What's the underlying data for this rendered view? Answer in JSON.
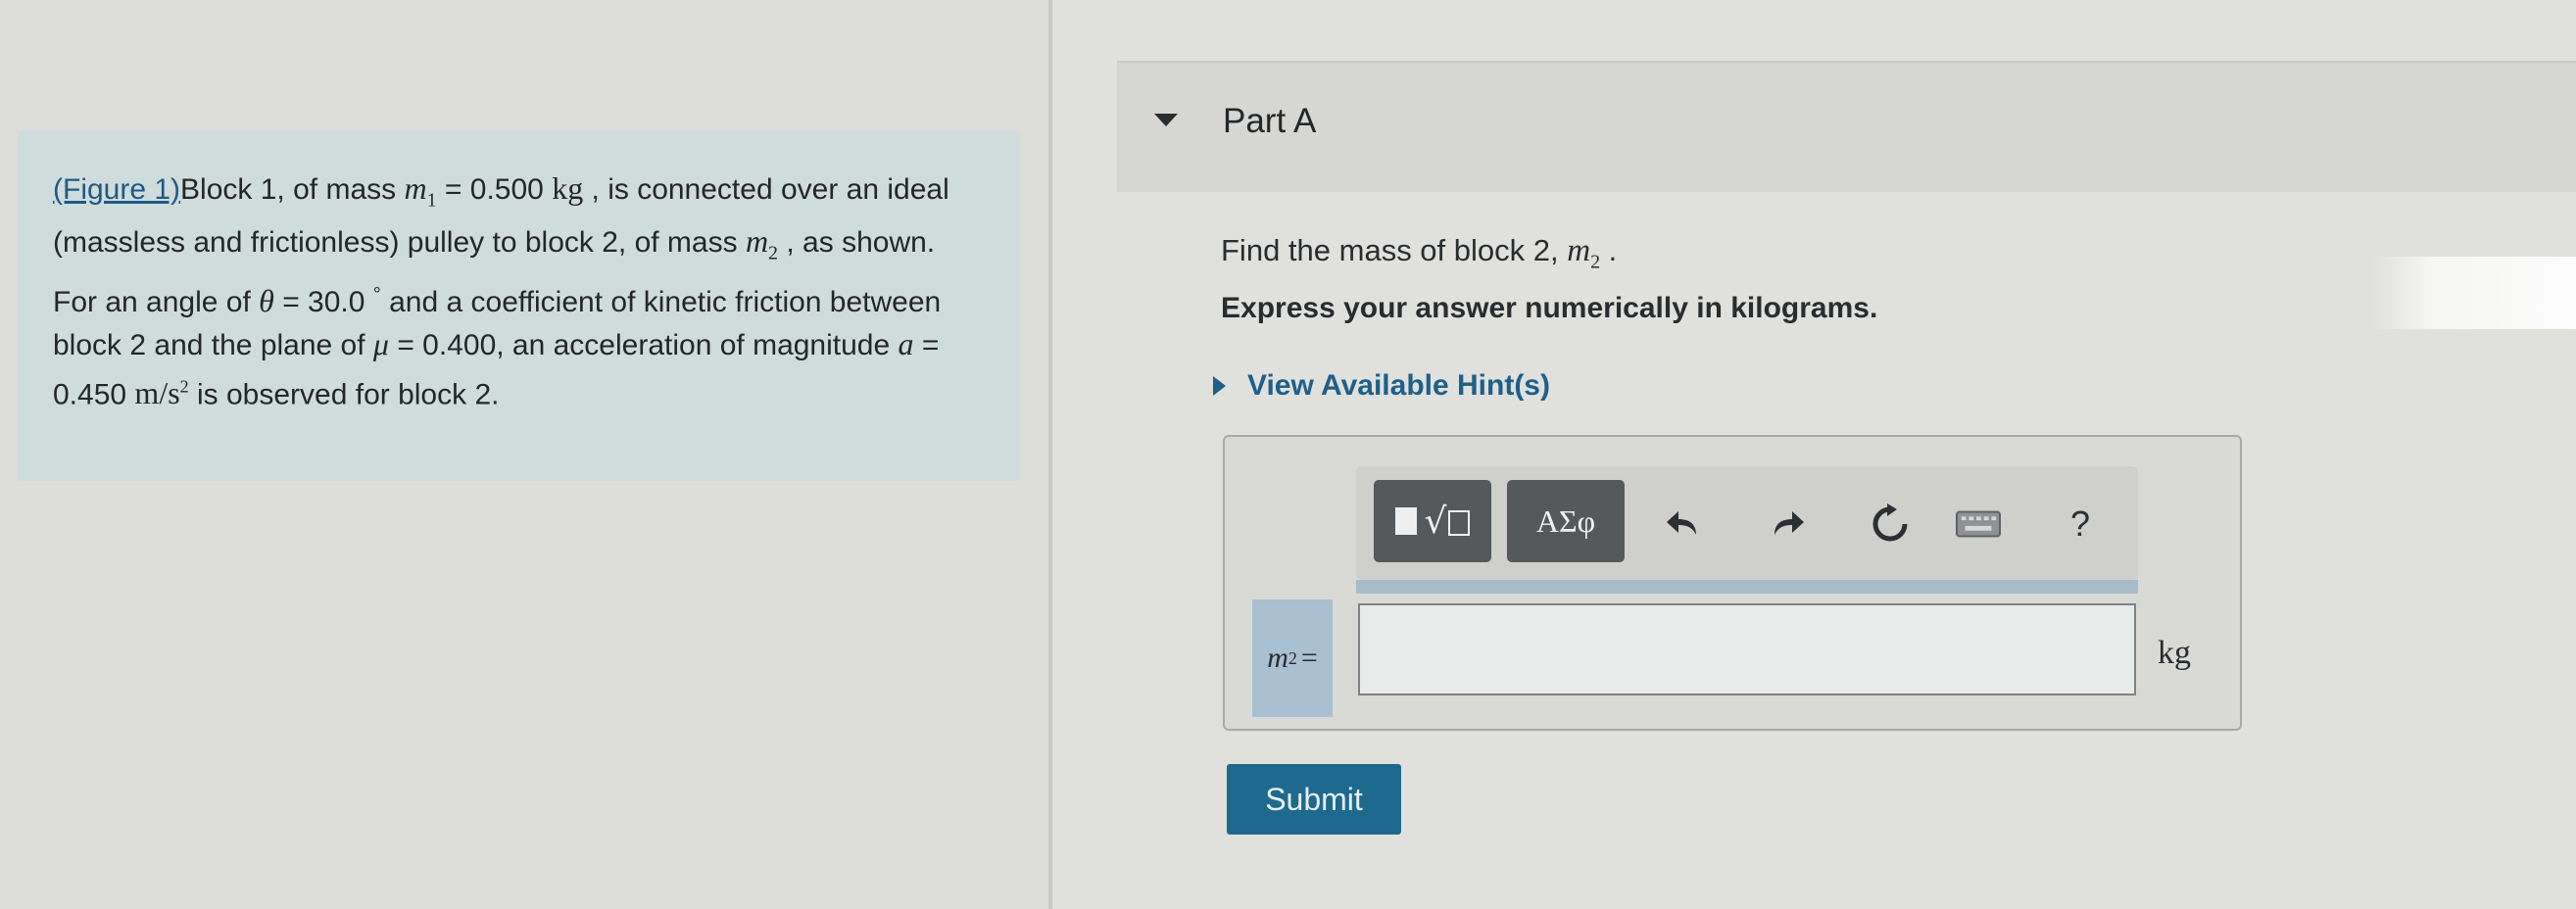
{
  "problem": {
    "figure_link": "(Figure 1)",
    "text_parts": {
      "p1": "Block 1, of mass ",
      "m1_symbol": "m",
      "m1_sub": "1",
      "eq1": " = 0.500 ",
      "unit_kg": "kg",
      "p2": " , is connected over an ideal (massless and frictionless) pulley to block 2, of mass ",
      "m2_symbol": "m",
      "m2_sub": "2",
      "p3": " , as shown. For an angle of ",
      "theta": "θ",
      "eq2": " = 30.0 ",
      "deg": "°",
      "p4": " and a coefficient of kinetic friction between block 2 and the plane of ",
      "mu": "μ",
      "eq3": " = 0.400, an acceleration of magnitude ",
      "a_symbol": "a",
      "eq4": " = 0.450 ",
      "accel_unit": "m/s",
      "accel_exp": "2",
      "p5": " is observed for block 2."
    }
  },
  "part": {
    "title": "Part A",
    "question_prefix": "Find the mass of block 2, ",
    "question_symbol": "m",
    "question_sub": "2",
    "question_suffix": " .",
    "instruction": "Express your answer numerically in kilograms.",
    "hint_label": "View Available Hint(s)"
  },
  "answer": {
    "var_symbol": "m",
    "var_sub": "2",
    "equals": "=",
    "value": "",
    "unit": "kg",
    "toolbar": {
      "symbols_label": "ΑΣφ",
      "help_label": "?"
    }
  },
  "submit_label": "Submit",
  "icons": {
    "caret": "caret-down-icon",
    "hint_arrow": "caret-right-icon",
    "templates": "templates-icon",
    "undo": "undo-icon",
    "redo": "redo-icon",
    "reset": "reset-icon",
    "keyboard": "keyboard-icon",
    "help": "help-icon"
  },
  "colors": {
    "link": "#1f5f8a",
    "submit_bg": "#1d6a8e",
    "problem_bg": "#cfdcdc",
    "var_label_bg": "#a9c0d3"
  }
}
